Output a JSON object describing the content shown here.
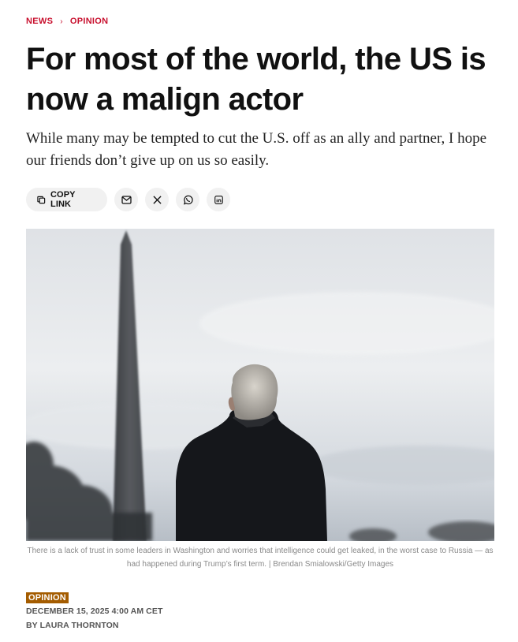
{
  "breadcrumb": {
    "items": [
      {
        "label": "NEWS"
      },
      {
        "label": "OPINION"
      }
    ],
    "separator": "›"
  },
  "article": {
    "headline": "For most of the world, the US is now a malign actor",
    "dek": "While many may be tempted to cut the U.S. off as an ally and partner, I hope our friends don’t give up on us so easily.",
    "share": {
      "copy_link_label": "COPY LINK",
      "buttons": [
        {
          "icon": "copy-link-icon"
        },
        {
          "icon": "email-icon"
        },
        {
          "icon": "x-icon"
        },
        {
          "icon": "whatsapp-icon"
        },
        {
          "icon": "linkedin-icon"
        }
      ]
    },
    "image": {
      "caption": "There is a lack of trust in some leaders in Washington and worries that intelligence could get leaked, in the worst case to Russia — as had happened during Trump’s first term. | Brendan Smialowski/Getty Images"
    },
    "section_tag": "OPINION",
    "dateline": "DECEMBER 15, 2025 4:00 AM CET",
    "byline": "BY LAURA THORNTON"
  },
  "colors": {
    "accent_red": "#c8102e",
    "tag_brown": "#a45c00",
    "pill_bg": "#f1f1f1"
  }
}
